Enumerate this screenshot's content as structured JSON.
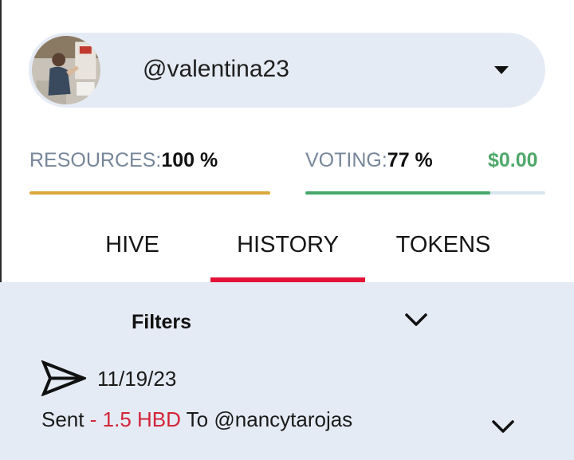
{
  "account": {
    "username": "@valentina23"
  },
  "stats": {
    "resources_label": "RESOURCES:",
    "resources_value": "100 %",
    "resources_fraction": 1.0,
    "voting_label": "VOTING:",
    "voting_value": "77 %",
    "voting_fraction": 0.77,
    "vote_value": "$0.00"
  },
  "tabs": [
    {
      "label": "HIVE",
      "active": false
    },
    {
      "label": "HISTORY",
      "active": true
    },
    {
      "label": "TOKENS",
      "active": false
    }
  ],
  "filters": {
    "label": "Filters"
  },
  "history": [
    {
      "icon": "send-icon",
      "date": "11/19/23",
      "action": "Sent",
      "separator": "-",
      "amount": "1.5 HBD",
      "preposition": "To",
      "counterparty": "@nancytarojas"
    }
  ],
  "colors": {
    "accent": "#e31337",
    "resources_bar": "#d9a73b",
    "voting_bar": "#43a86a",
    "vote_value": "#4fa86a",
    "panel_bg": "#e5ebf4",
    "amount_negative": "#d3253a"
  }
}
